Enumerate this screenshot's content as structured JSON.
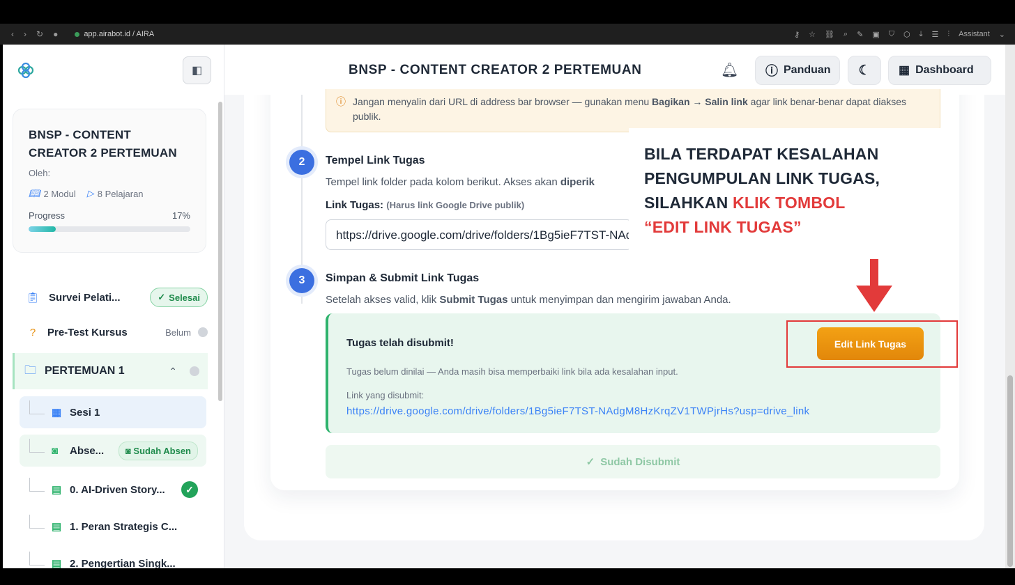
{
  "browser": {
    "url": "app.airabot.id / AIRA",
    "assistant_label": "Assistant"
  },
  "header": {
    "title": "BNSP - CONTENT CREATOR 2 PERTEMUAN",
    "panduan_label": "Panduan",
    "dashboard_label": "Dashboard"
  },
  "sidebar": {
    "course": {
      "title": "BNSP - CONTENT CREATOR 2 PERTEMUAN",
      "byline": "Oleh:",
      "modules": "2 Modul",
      "lessons": "8 Pelajaran",
      "progress_label": "Progress",
      "progress_value": "17%",
      "progress_fraction": 0.17
    },
    "items": [
      {
        "label": "Survei Pelati...",
        "badge": "Selesai"
      },
      {
        "label": "Pre-Test Kursus",
        "status": "Belum"
      },
      {
        "label": "PERTEMUAN 1"
      }
    ],
    "sub_items": [
      {
        "label": "Sesi 1"
      },
      {
        "label": "Abse...",
        "badge": "Sudah Absen"
      },
      {
        "label": "0. AI-Driven Story..."
      },
      {
        "label": "1. Peran Strategis C..."
      },
      {
        "label": "2. Pengertian Singk..."
      }
    ]
  },
  "main": {
    "warning": {
      "text_1": "Jangan menyalin dari URL di address bar browser — gunakan menu ",
      "bold_1": "Bagikan",
      "arrow": " → ",
      "bold_2": "Salin link",
      "text_2": " agar link benar-benar dapat diakses publik."
    },
    "step2": {
      "number": "2",
      "title": "Tempel Link Tugas",
      "desc_1": "Tempel link folder pada kolom berikut. Akses akan ",
      "desc_bold": "diperik",
      "field_label": "Link Tugas:",
      "field_hint": "(Harus link Google Drive publik)",
      "field_value": "https://drive.google.com/drive/folders/1Bg5ieF7TST-NAdgM8HzKrqZV1TWPjrHs?usp=drive_link"
    },
    "step3": {
      "number": "3",
      "title": "Simpan & Submit Link Tugas",
      "desc_1": "Setelah akses valid, klik ",
      "desc_bold": "Submit Tugas",
      "desc_2": " untuk menyimpan dan mengirim jawaban Anda."
    },
    "submitted": {
      "title": "Tugas telah disubmit!",
      "note": "Tugas belum dinilai — Anda masih bisa memperbaiki link bila ada kesalahan input.",
      "link_label": "Link yang disubmit:",
      "link": "https://drive.google.com/drive/folders/1Bg5ieF7TST-NAdgM8HzKrqZV1TWPjrHs?usp=drive_link",
      "edit_button": "Edit Link Tugas"
    },
    "done_button": "Sudah Disubmit"
  },
  "callout": {
    "line1": "BILA TERDAPAT KESALAHAN",
    "line2": "PENGUMPULAN LINK TUGAS,",
    "line3_a": "SILAHKAN ",
    "line3_b": "KLIK TOMBOL",
    "line4": "“EDIT LINK TUGAS”"
  },
  "colors": {
    "accent_blue": "#3b6fe0",
    "success_green": "#2fb36d",
    "edit_orange": "#e8900e",
    "callout_red": "#e23a3a"
  }
}
